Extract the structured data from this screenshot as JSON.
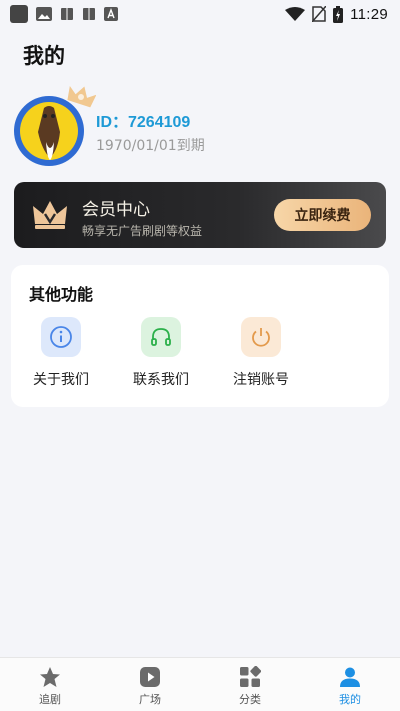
{
  "status_bar": {
    "time": "11:29"
  },
  "page": {
    "title": "我的"
  },
  "profile": {
    "id_text": "ID：7264109",
    "expire_text": "1970/01/01到期"
  },
  "member": {
    "title": "会员中心",
    "subtitle": "畅享无广告刷剧等权益",
    "renew_label": "立即续费",
    "accent_color": "#eab47a"
  },
  "functions": {
    "title": "其他功能",
    "items": [
      {
        "label": "关于我们",
        "icon": "info-icon",
        "color": "#4a86e8"
      },
      {
        "label": "联系我们",
        "icon": "headphones-icon",
        "color": "#2bb04a"
      },
      {
        "label": "注销账号",
        "icon": "power-icon",
        "color": "#e39a4c"
      }
    ]
  },
  "bottom_nav": {
    "items": [
      {
        "label": "追剧",
        "icon": "star-icon",
        "active": false
      },
      {
        "label": "广场",
        "icon": "play-icon",
        "active": false
      },
      {
        "label": "分类",
        "icon": "category-icon",
        "active": false
      },
      {
        "label": "我的",
        "icon": "user-icon",
        "active": true
      }
    ],
    "active_color": "#1d8fe3"
  }
}
